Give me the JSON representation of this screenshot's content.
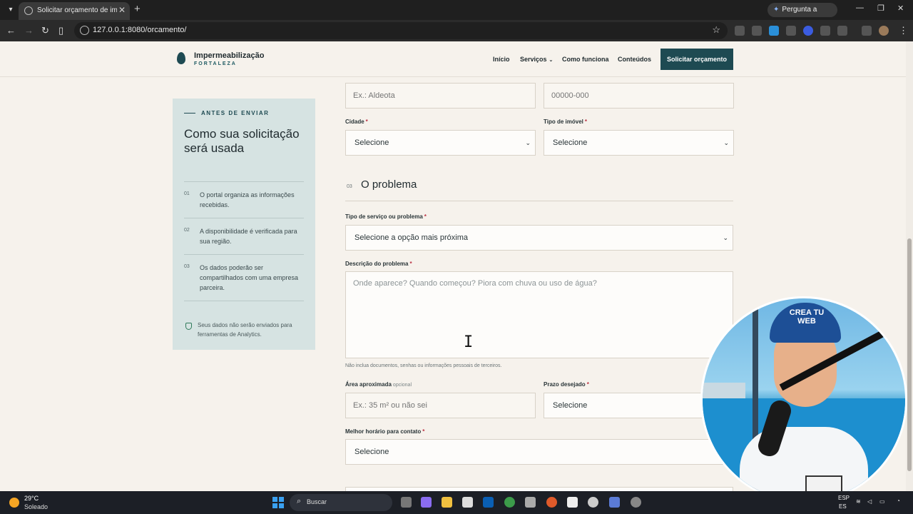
{
  "browser": {
    "tab_title": "Solicitar orçamento de imperm",
    "url": "127.0.0.1:8080/orcamento/",
    "gemini_label": "Pergunta a Gemini"
  },
  "site": {
    "brand_name": "Impermeabilização",
    "brand_sub": "FORTALEZA",
    "nav": [
      "Início",
      "Serviços",
      "Como funciona",
      "Conteúdos"
    ],
    "cta": "Solicitar orçamento"
  },
  "sidebar": {
    "kicker": "ANTES DE ENVIAR",
    "title": "Como sua solicitação será usada",
    "items": [
      {
        "num": "01",
        "text": "O portal organiza as informações recebidas."
      },
      {
        "num": "02",
        "text": "A disponibilidade é verificada para sua região."
      },
      {
        "num": "03",
        "text": "Os dados poderão ser compartilhados com uma empresa parceira."
      }
    ],
    "note": "Seus dados não serão enviados para ferramentas de Analytics."
  },
  "form": {
    "bairro_placeholder": "Ex.: Aldeota",
    "cep_placeholder": "00000-000",
    "cidade_label": "Cidade",
    "cidade_value": "Selecione",
    "tipo_imovel_label": "Tipo de imóvel",
    "tipo_imovel_value": "Selecione",
    "section_num": "03",
    "section_title": "O problema",
    "tipo_servico_label": "Tipo de serviço ou problema",
    "tipo_servico_value": "Selecione a opção mais próxima",
    "descricao_label": "Descrição do problema",
    "descricao_placeholder": "Onde aparece? Quando começou? Piora com chuva ou uso de água?",
    "descricao_help": "Não inclua documentos, senhas ou informações pessoais de terceiros.",
    "area_label": "Área aproximada",
    "area_optional": "opcional",
    "area_placeholder": "Ex.: 35 m² ou não sei",
    "prazo_label": "Prazo desejado",
    "prazo_value": "Selecione",
    "horario_label": "Melhor horário para contato",
    "horario_value": "Selecione",
    "required_mark": "*"
  },
  "webcam": {
    "cap_text": "CREA TU WEB"
  },
  "taskbar": {
    "temperature": "29°C",
    "weather": "Soleado",
    "search_label": "Buscar",
    "lang_top": "ESP",
    "lang_bottom": "ES"
  },
  "colors": {
    "accent": "#1e4a52",
    "page_bg": "#f6f2ec",
    "sidebar_bg": "#d6e3e2"
  }
}
